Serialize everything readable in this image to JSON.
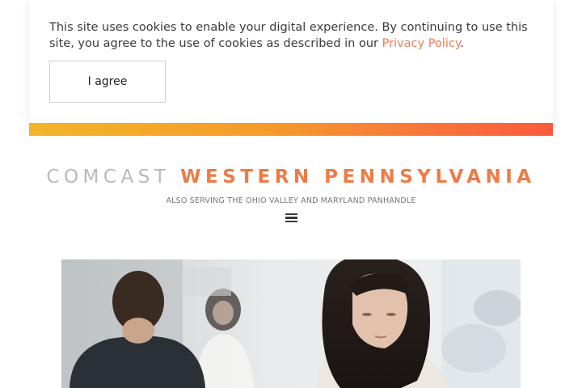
{
  "cookie_banner": {
    "text": "This site uses cookies to enable your digital experience. By continuing to use this site, you agree to the use of cookies as described in our",
    "link_text": "Privacy Policy",
    "trailing": ".",
    "agree_label": "I agree"
  },
  "header": {
    "brand": "COMCAST",
    "region": "WESTERN PENNSYLVANIA",
    "subtitle": "ALSO SERVING THE OHIO VALLEY AND MARYLAND PANHANDLE",
    "menu_icon": "hamburger-menu-icon"
  },
  "colors": {
    "accent": "#ee7b45",
    "link": "#f07b52",
    "gradient_start": "#f2b52a",
    "gradient_end": "#fa5a3c"
  }
}
